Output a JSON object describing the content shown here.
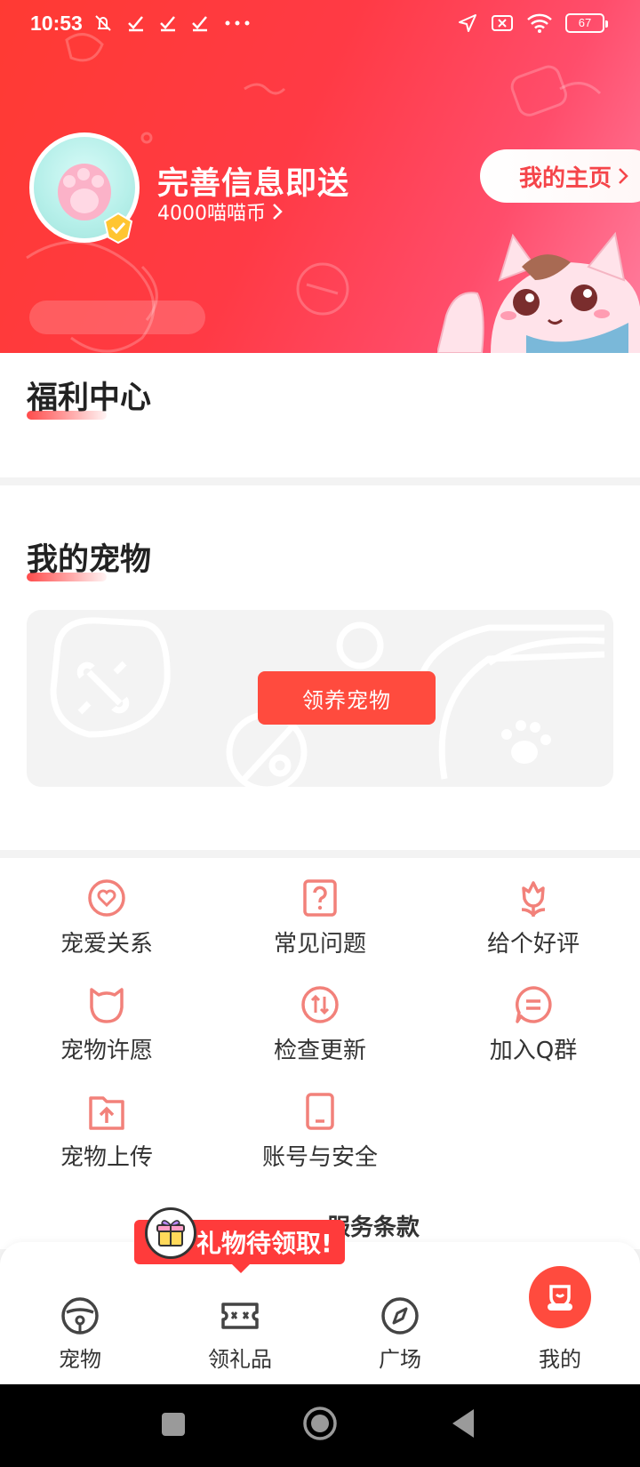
{
  "status_bar": {
    "time": "10:53",
    "battery": "67",
    "icons": [
      "mute-icon",
      "check-icon",
      "check-icon",
      "check-icon",
      "more-icon",
      "location-icon",
      "sim-off-icon",
      "wifi-icon",
      "battery-icon"
    ]
  },
  "header": {
    "promo_title": "完善信息即送",
    "promo_sub": "4000喵喵币",
    "homepage_button": "我的主页"
  },
  "welfare": {
    "title": "福利中心"
  },
  "pets": {
    "title": "我的宠物",
    "adopt_button": "领养宠物"
  },
  "menu": {
    "items": [
      {
        "label": "宠爱关系",
        "icon": "heart-circle-icon"
      },
      {
        "label": "常见问题",
        "icon": "question-icon"
      },
      {
        "label": "给个好评",
        "icon": "flower-icon"
      },
      {
        "label": "宠物许愿",
        "icon": "cat-head-icon"
      },
      {
        "label": "检查更新",
        "icon": "update-icon"
      },
      {
        "label": "加入Q群",
        "icon": "chat-icon"
      },
      {
        "label": "宠物上传",
        "icon": "upload-folder-icon"
      },
      {
        "label": "账号与安全",
        "icon": "phone-icon"
      }
    ],
    "terms": "服务条款"
  },
  "gift_tip": {
    "text": "礼物待领取!"
  },
  "bottom_nav": {
    "items": [
      {
        "label": "宠物",
        "icon": "pet-icon"
      },
      {
        "label": "领礼品",
        "icon": "gift-ticket-icon"
      },
      {
        "label": "广场",
        "icon": "compass-icon"
      },
      {
        "label": "我的",
        "icon": "profile-icon"
      }
    ],
    "active": "我的"
  },
  "colors": {
    "brand_red": "#ff4b3e",
    "menu_icon": "#f2817a"
  }
}
